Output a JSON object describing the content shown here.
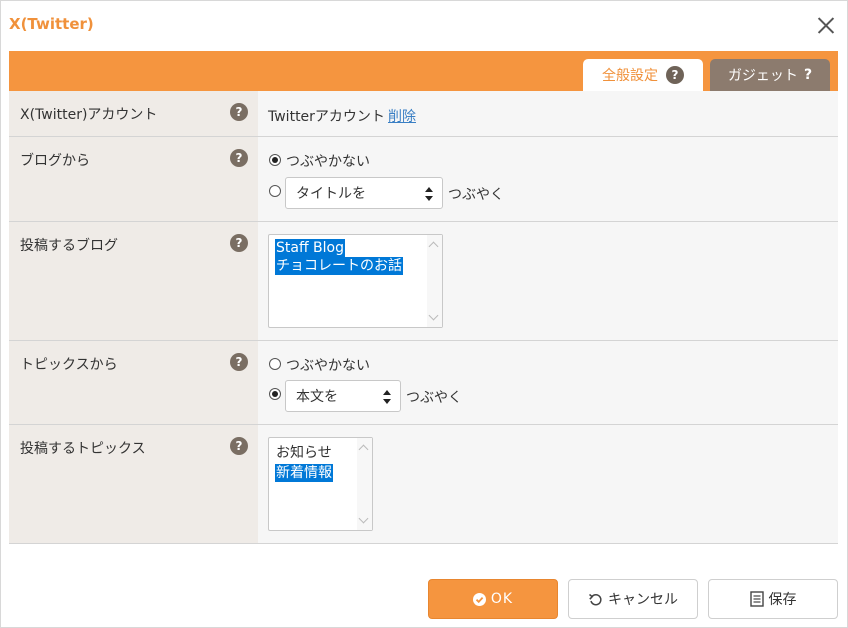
{
  "dialog": {
    "title": "X(Twitter)"
  },
  "tabs": {
    "general": {
      "label": "全般設定",
      "icon": "?"
    },
    "gadget": {
      "label": "ガジェット",
      "icon": "?"
    }
  },
  "help_icon": "?",
  "rows": {
    "account": {
      "label": "X(Twitter)アカウント",
      "value": "Twitterアカウント",
      "delete_link": "削除"
    },
    "from_blog": {
      "label": "ブログから",
      "option_no_tweet": "つぶやかない",
      "select_value": "タイトルを",
      "option_tweet_suffix": "つぶやく",
      "selected": "no_tweet"
    },
    "post_blog": {
      "label": "投稿するブログ",
      "items": [
        "Staff Blog",
        "チョコレートのお話"
      ],
      "selected": [
        true,
        true
      ]
    },
    "from_topics": {
      "label": "トピックスから",
      "option_no_tweet": "つぶやかない",
      "select_value": "本文を",
      "option_tweet_suffix": "つぶやく",
      "selected": "tweet"
    },
    "post_topics": {
      "label": "投稿するトピックス",
      "items": [
        "お知らせ",
        "新着情報"
      ],
      "selected": [
        false,
        true
      ]
    }
  },
  "buttons": {
    "ok": {
      "label": "OK",
      "icon": "check-circle-icon"
    },
    "cancel": {
      "label": "キャンセル",
      "icon": "undo-icon"
    },
    "save": {
      "label": "保存",
      "icon": "document-icon"
    }
  },
  "colors": {
    "accent": "#f5953f",
    "gadget_tab": "#8c7b6e",
    "selection": "#0078d7",
    "link": "#3a7fc4"
  }
}
